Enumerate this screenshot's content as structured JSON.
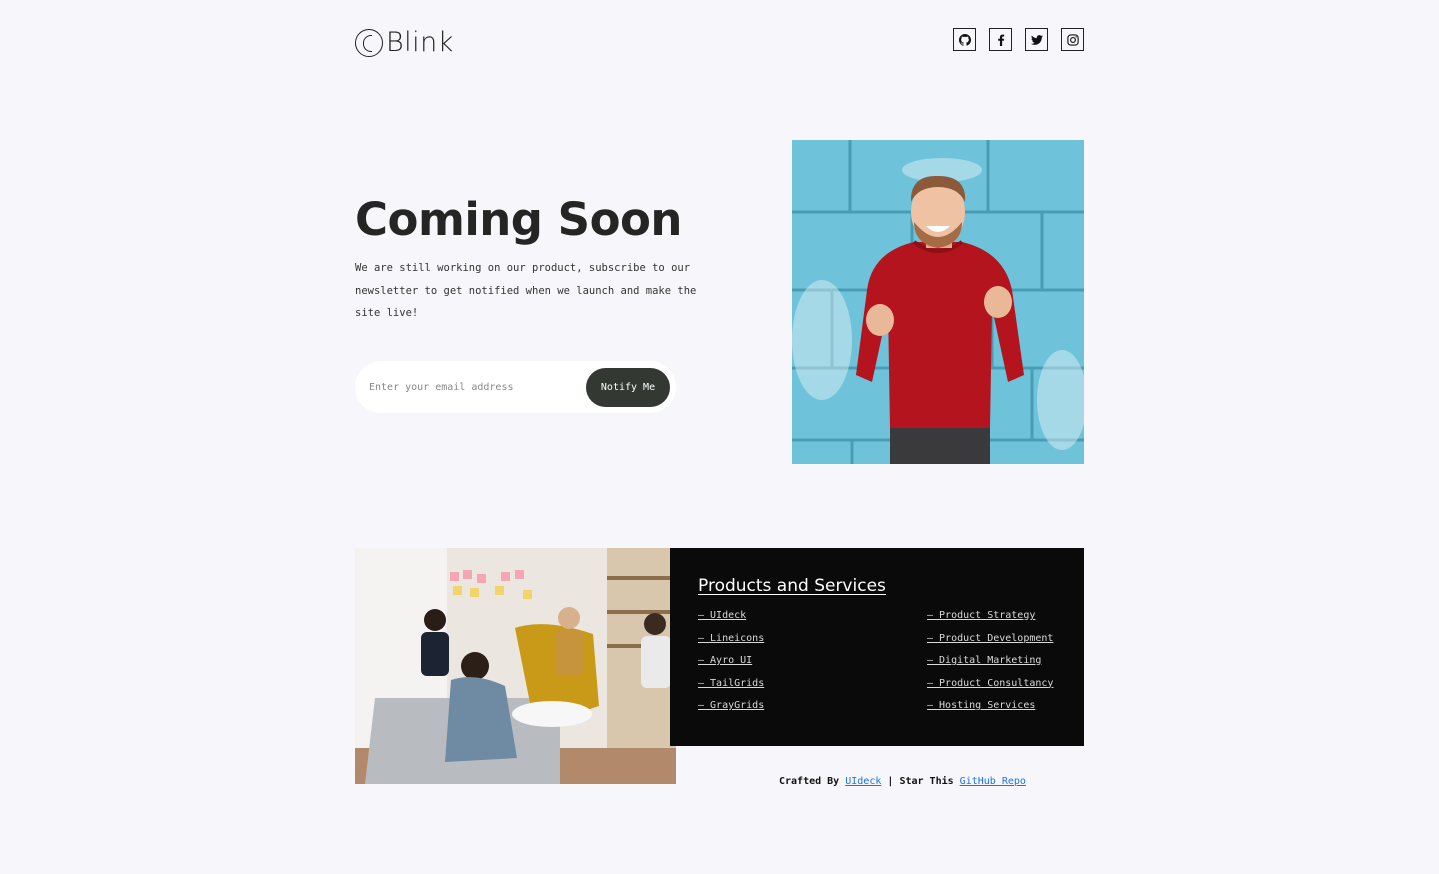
{
  "brand": {
    "name": "Blink"
  },
  "social": [
    {
      "name": "github-icon"
    },
    {
      "name": "facebook-icon"
    },
    {
      "name": "twitter-icon"
    },
    {
      "name": "instagram-icon"
    }
  ],
  "hero": {
    "title": "Coming Soon",
    "description": "We are still working on our product, subscribe to our newsletter to get notified when we launch and make the site live!",
    "email_placeholder": "Enter your email address",
    "email_value": "",
    "button_label": "Notify Me"
  },
  "services": {
    "title": "Products and Services",
    "left": [
      "– UIdeck",
      "– Lineicons",
      "– Ayro UI",
      "– TailGrids",
      "– GrayGrids"
    ],
    "right": [
      "– Product Strategy",
      "– Product Development",
      "– Digital Marketing",
      "– Product Consultancy",
      "– Hosting Services"
    ]
  },
  "footer": {
    "crafted_by": "Crafted By",
    "crafted_link": "UIdeck",
    "separator": "| Star This",
    "repo_link": "GitHub Repo"
  },
  "colors": {
    "background": "#f7f7fb",
    "button": "#333833",
    "panel": "#0a0a0a",
    "link": "#1a73e8"
  }
}
